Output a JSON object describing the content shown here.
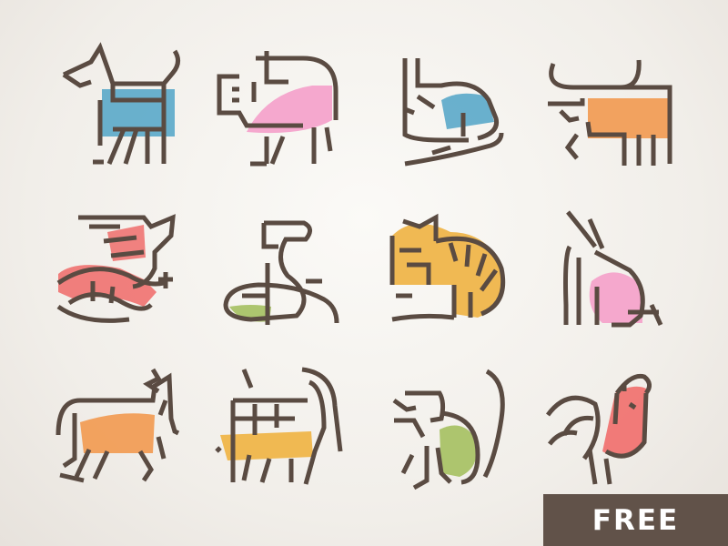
{
  "badge": {
    "label": "FREE"
  },
  "colors": {
    "stroke": "#5a4b42",
    "blue": "#5aa9c9",
    "pink": "#f4a3cb",
    "orange": "#f29b52",
    "red": "#f07472",
    "green": "#a9c267",
    "gold": "#efb54a",
    "badge_bg": "#615249"
  },
  "icons": [
    {
      "name": "dog-icon",
      "accent": "#5aa9c9"
    },
    {
      "name": "pig-icon",
      "accent": "#f4a3cb"
    },
    {
      "name": "rat-icon",
      "accent": "#5aa9c9"
    },
    {
      "name": "ox-icon",
      "accent": "#f29b52"
    },
    {
      "name": "dragon-icon",
      "accent": "#f07472"
    },
    {
      "name": "snake-icon",
      "accent": "#a9c267"
    },
    {
      "name": "tiger-icon",
      "accent": "#efb54a"
    },
    {
      "name": "rabbit-icon",
      "accent": "#f4a3cb"
    },
    {
      "name": "horse-icon",
      "accent": "#f29b52"
    },
    {
      "name": "goat-icon",
      "accent": "#efb54a"
    },
    {
      "name": "monkey-icon",
      "accent": "#a9c267"
    },
    {
      "name": "rooster-icon",
      "accent": "#f07472"
    }
  ]
}
